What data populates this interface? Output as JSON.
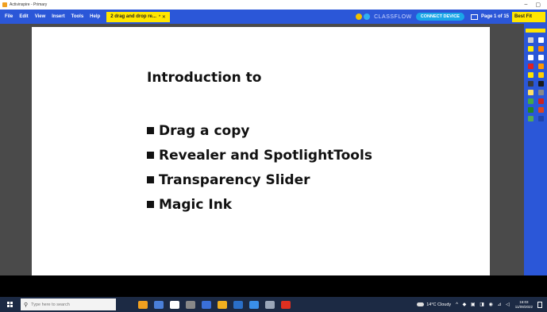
{
  "window": {
    "title": "Activinspire - Primary",
    "minimize": "–",
    "maximize": "▢"
  },
  "menu": {
    "items": [
      "File",
      "Edit",
      "View",
      "Insert",
      "Tools",
      "Help"
    ],
    "document_tab": "2 drag and drop re...",
    "tab_close": "* ✕",
    "classflow": "CLASSFLOW",
    "connect_device": "CONNECT DEVICE",
    "page_label": "Page 1 of 15",
    "zoom": "Best Fit"
  },
  "slide": {
    "title": "Introduction to",
    "bullets": [
      "Drag a copy",
      "Revealer and SpotlightTools",
      "Transparency Slider",
      "Magic Ink"
    ]
  },
  "toolbox": {
    "icons": [
      "select-tool-icon",
      "page-tool-icon",
      "pen-tool-icon",
      "highlighter-tool-icon",
      "eraser-tool-icon",
      "shape-tool-icon",
      "fill-tool-icon",
      "text-tool-icon",
      "connector-tool-icon",
      "camera-tool-icon",
      "undo-tool-icon",
      "redo-tool-icon",
      "magic-ink-tool-icon",
      "revealer-tool-icon",
      "spotlight-tool-icon",
      "clock-tool-icon",
      "dice-tool-icon",
      "record-tool-icon",
      "container-tool-icon",
      "trash-tool-icon"
    ],
    "colors": [
      "#d0d0d0",
      "#ffffff",
      "#ffee00",
      "#ff8800",
      "#ffffff",
      "#ffffff",
      "#e02020",
      "#ff9900",
      "#ffe600",
      "#ffd000",
      "#3a3a3a",
      "#1a1a1a",
      "#ffe066",
      "#888888",
      "#44aa44",
      "#cc2222",
      "#228822",
      "#dd4422",
      "#55aa55",
      "#2244aa"
    ]
  },
  "taskbar": {
    "search_placeholder": "Type here to search",
    "weather": "14°C Cloudy",
    "time": "16:03",
    "date": "11/09/2022",
    "tray": "^ ◆ ▣ ◨ ◉ ⊿ ◁",
    "apps": [
      "#f0a020",
      "#4a7fd8",
      "#ffffff",
      "#888888",
      "#3a6fd8",
      "#f0b020",
      "#2a6fc8",
      "#3a8fe8",
      "#9aa6b8",
      "#e03020"
    ]
  },
  "colors": {
    "accent": "#2b57d8",
    "highlight": "#ffe600",
    "connect": "#1aa6e8"
  }
}
